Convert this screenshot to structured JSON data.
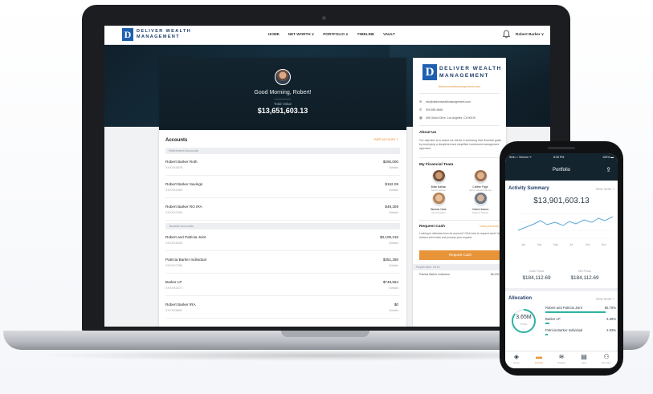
{
  "web": {
    "logo_mark": "D",
    "logo_line1": "DELIVER WEALTH",
    "logo_line2": "MANAGEMENT",
    "nav": [
      "HOME",
      "NET WORTH ∨",
      "PORTFOLIO ∨",
      "TIMELINE",
      "VAULT"
    ],
    "user_menu": "Robert Barker ∨",
    "greeting": "Good Morning, Robert!",
    "total_value_label": "Total Value",
    "total_value": "$13,651,603.13",
    "accounts_title": "Accounts",
    "add_account": "Add account  +",
    "section_retirement": "Retirement Accounts",
    "section_taxable": "Taxable Accounts",
    "accounts": [
      {
        "name": "Robert Barker Roth",
        "number": "XXXXX4878",
        "value": "$290,000",
        "status": "Details"
      },
      {
        "name": "Robert Barker Savings",
        "number": "XXXXX2469",
        "value": "$162.09",
        "status": "Details"
      },
      {
        "name": "Robert Barker RO IRA",
        "number": "XXXXX7904",
        "value": "$49,309",
        "status": "Details"
      },
      {
        "name": "Robert and Patricia Joint",
        "number": "XXXXX3025",
        "value": "$3,109,218",
        "status": "Details"
      },
      {
        "name": "Patricia Barker Individual",
        "number": "XXXXX7256",
        "value": "$351,268",
        "status": "Details"
      },
      {
        "name": "Barker LP",
        "number": "XXXXX2471",
        "value": "$748,564",
        "status": "Details"
      },
      {
        "name": "Robert Barker IRA",
        "number": "XXXXX6802",
        "value": "$0",
        "status": "Details"
      }
    ],
    "side": {
      "logo_line1": "DELIVER WEALTH",
      "logo_line2": "MANAGEMENT",
      "website": "deliverwealthmanagement.com",
      "email": "info@deliverwealthmanagement.com",
      "phone": "909-555-5668",
      "address": "456 Grand Drive, Los Angeles, CA 90019",
      "about_title": "About Us",
      "about_body": "Our objective is to assist our clients in achieving their financial goals by employing a disciplined and simplified investment management approach.",
      "team_title": "My Financial Team",
      "team": [
        {
          "name": "Brian Nathan",
          "role": "Senior Advisor",
          "color": "#7a5236"
        },
        {
          "name": "Colleen Page",
          "role": "Senior Wealth Planner",
          "color": "#a0714e"
        },
        {
          "name": "Brianne Clark",
          "role": "Vice President",
          "color": "#b78357"
        },
        {
          "name": "Calvin Hudson",
          "role": "Head of Trading",
          "color": "#6d7884"
        }
      ],
      "request_title": "Request Cash",
      "request_link": "View previous  >",
      "request_body": "Looking to withdraw from an account? Click here to request cash! Your Advisor will review and process your request.",
      "request_button": "Request Cash",
      "request_table_header": "September 2019",
      "request_row_name": "Patricia Barker Individual",
      "request_row_value": "$5,000.00"
    }
  },
  "mobile": {
    "carrier": "●●●○○ Verizon ᯤ",
    "time": "8:30 PM",
    "battery": "100% ▬",
    "title": "Portfolio",
    "activity_title": "Activity Summary",
    "view_more": "View more  >",
    "activity_value": "$13,901,603.13",
    "x_ticks": [
      "Jan",
      "Mar",
      "May",
      "Jul",
      "Sep",
      "Nov"
    ],
    "cash_flows_label": "Cash Flows",
    "net_flows_label": "Net Flows",
    "cash_flows_value": "$184,112.69",
    "net_flows_value": "$184,112.69",
    "allocation_title": "Allocation",
    "allocation_total": "3.65M",
    "allocation_total_sub": "TOTAL",
    "allocation": [
      {
        "name": "Robert and Patricia Joint",
        "pct": "85.75%",
        "share": 0.8575
      },
      {
        "name": "Barker LP",
        "pct": "5.38%",
        "share": 0.0538
      },
      {
        "name": "Patricia Barker Individual",
        "pct": "2.93%",
        "share": 0.0293
      }
    ],
    "tabs": [
      "Home",
      "Portfolio",
      "Timeline",
      "Vault",
      "My Team"
    ],
    "tab_icons": [
      "◈",
      "▬",
      "≋",
      "▤",
      "⚇"
    ],
    "accent": "#e8953a",
    "teal": "#2fb3a3"
  }
}
